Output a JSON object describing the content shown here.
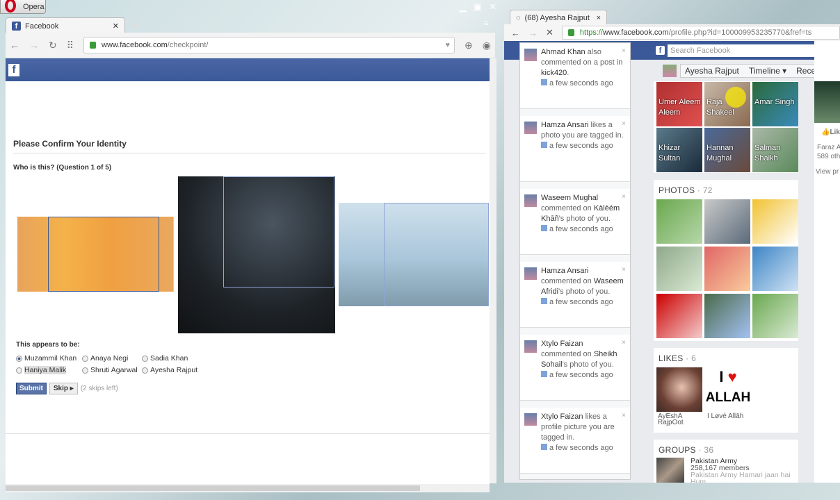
{
  "left_window": {
    "app_button": "Opera",
    "tab_title": "Facebook",
    "url_host": "www.facebook.com",
    "url_path": "/checkpoint/",
    "heading": "Please Confirm Your Identity",
    "question": "Who is this? (Question 1 of 5)",
    "appears_label": "This appears to be:",
    "options": [
      {
        "label": "Muzammil Khan",
        "checked": true
      },
      {
        "label": "Anaya Negi",
        "checked": false
      },
      {
        "label": "Sadia Khan",
        "checked": false
      },
      {
        "label": "Haniya Malik",
        "checked": false
      },
      {
        "label": "Shruti Agarwal",
        "checked": false
      },
      {
        "label": "Ayesha Rajput",
        "checked": false
      }
    ],
    "submit": "Submit",
    "skip": "Skip",
    "skips_left": "(2 skips left)"
  },
  "right_window": {
    "tab_title": "(68) Ayesha Rajput",
    "url_scheme": "https://",
    "url_host": "www.facebook.com",
    "url_path": "/profile.php?id=100009953235770&fref=ts",
    "search_placeholder": "Search Facebook",
    "profile_name": "Ayesha Rajput",
    "timeline": "Timeline",
    "recent": "Recent",
    "notifications": [
      {
        "name": "Ahmad Khan",
        "text": " also commented on a post in ",
        "target": "kick420",
        "tail": ".",
        "time": "a few seconds ago"
      },
      {
        "name": "Hamza Ansari",
        "text": " likes a photo you are tagged in.",
        "target": "",
        "tail": "",
        "time": "a few seconds ago"
      },
      {
        "name": "Waseem Mughal",
        "text": " commented on ",
        "target": "Kàlèém Khāñ",
        "tail": "'s photo of you.",
        "time": "a few seconds ago"
      },
      {
        "name": "Hamza Ansari",
        "text": " commented on ",
        "target": "Waseem Afridi",
        "tail": "'s photo of you.",
        "time": "a few seconds ago"
      },
      {
        "name": "Xtylo Faizan",
        "text": " commented on ",
        "target": "Sheikh Sohail",
        "tail": "'s photo of you.",
        "time": "a few seconds ago"
      },
      {
        "name": "Xtylo Faizan",
        "text": " likes a profile picture you are tagged in.",
        "target": "",
        "tail": "",
        "time": "a few seconds ago"
      }
    ],
    "friends": [
      "Umer Aleem Aleem",
      "Raja Shakeel",
      "Amar Singh",
      "Khizar Sultan",
      "Hannan Mughal",
      "Salman Shaikh"
    ],
    "photos_label": "PHOTOS",
    "photos_count": "· 72",
    "likes_label": "LIKES",
    "likes_count": "· 6",
    "likes": [
      "AyEshA RajpOot",
      "I Løvé Allāh"
    ],
    "like_logo": "I ♥ ALLAH",
    "groups_label": "GROUPS",
    "groups_count": "· 36",
    "group": {
      "name": "Pakistan Army",
      "members": "258,167 members",
      "desc": "Pakistan Army Hamari jaan hai Hum"
    },
    "side": {
      "like": "Like",
      "faraz": "Faraz A",
      "others": "589 oth",
      "view": "View pr"
    }
  }
}
